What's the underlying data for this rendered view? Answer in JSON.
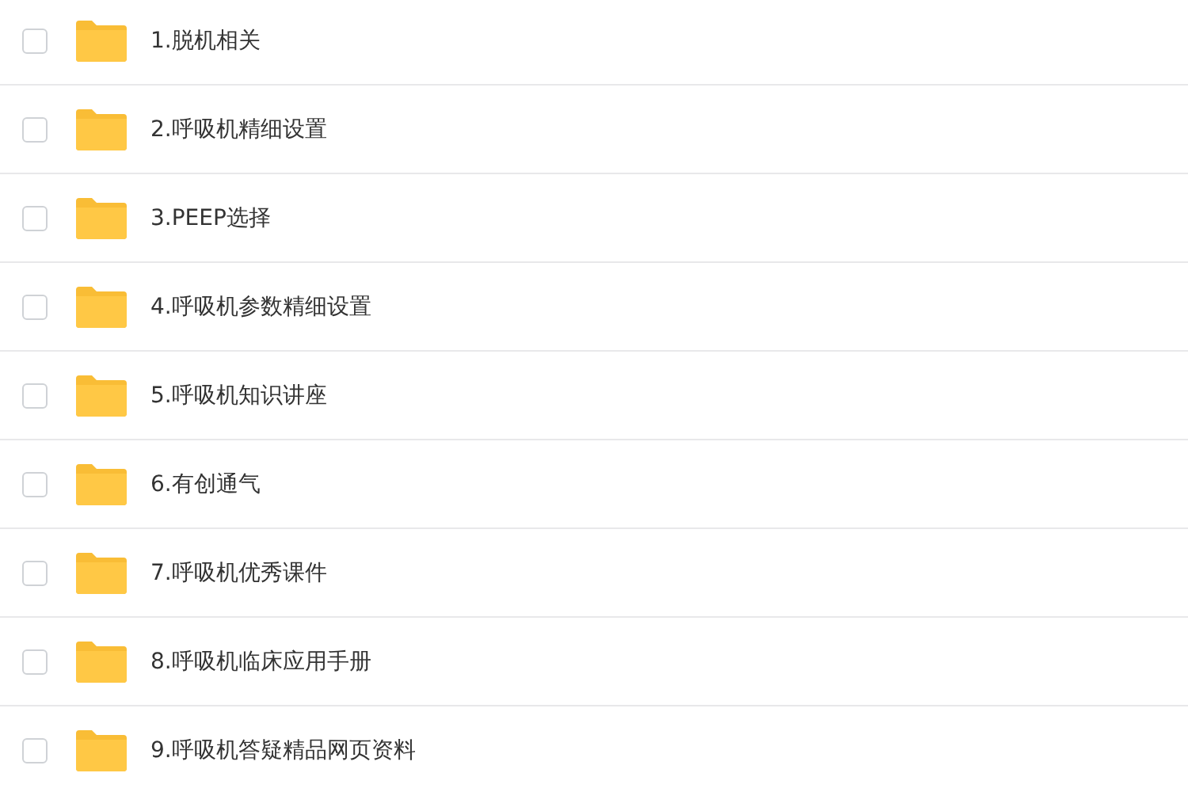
{
  "files": [
    {
      "name": "1.脱机相关",
      "checked": false
    },
    {
      "name": "2.呼吸机精细设置",
      "checked": false
    },
    {
      "name": "3.PEEP选择",
      "checked": false
    },
    {
      "name": "4.呼吸机参数精细设置",
      "checked": false
    },
    {
      "name": "5.呼吸机知识讲座",
      "checked": false
    },
    {
      "name": "6.有创通气",
      "checked": false
    },
    {
      "name": "7.呼吸机优秀课件",
      "checked": false
    },
    {
      "name": "8.呼吸机临床应用手册",
      "checked": false
    },
    {
      "name": "9.呼吸机答疑精品网页资料",
      "checked": false
    }
  ]
}
